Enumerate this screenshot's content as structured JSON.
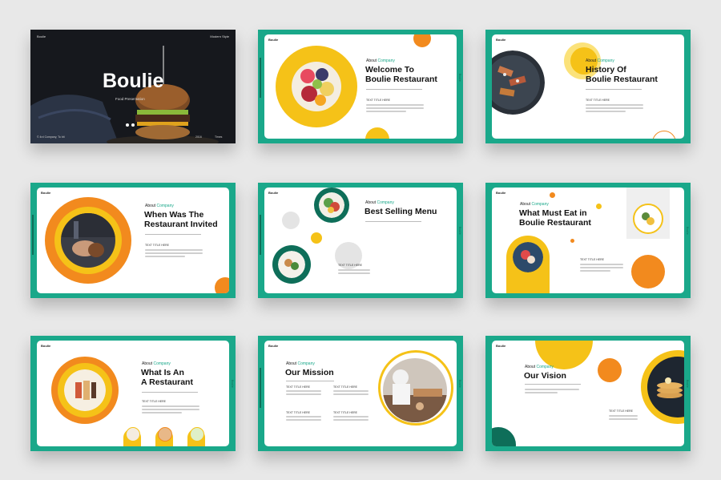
{
  "colors": {
    "green": "#1aa88a",
    "yellow": "#f5c218",
    "orange": "#f28a1e",
    "dark_green": "#0e6e59"
  },
  "slide1": {
    "brand": "Boulie",
    "tag": "Modern Style",
    "title": "Boulie",
    "subtitle": "Food Presentation",
    "footer_left": "© 4rd Company, To bit",
    "footer_year": "2016",
    "footer_right": "Times"
  },
  "slide2": {
    "brand": "Boulie",
    "eyebrow_a": "About",
    "eyebrow_b": "Company",
    "title_line1": "Welcome To",
    "title_line2": "Boulie Restaurant",
    "text_title": "TEXT TITLE HERE"
  },
  "slide3": {
    "brand": "Boulie",
    "eyebrow_a": "About",
    "eyebrow_b": "Company",
    "title_line1": "History Of",
    "title_line2": "Boulie Restaurant",
    "text_title": "TEXT TITLE HERE"
  },
  "slide4": {
    "brand": "Boulie",
    "eyebrow_a": "About",
    "eyebrow_b": "Company",
    "title_line1": "When Was The",
    "title_line2": "Restaurant Invited",
    "text_title": "TEXT TITLE HERE"
  },
  "slide5": {
    "brand": "Boulie",
    "eyebrow_a": "About",
    "eyebrow_b": "Company",
    "title_line1": "Best Selling Menu",
    "text_title": "TEXT TITLE HERE"
  },
  "slide6": {
    "brand": "Boulie",
    "eyebrow_a": "About",
    "eyebrow_b": "Company",
    "title_line1": "What Must Eat in",
    "title_line2": "Boulie Restaurant",
    "text_title": "TEXT TITLE HERE"
  },
  "slide7": {
    "brand": "Boulie",
    "eyebrow_a": "About",
    "eyebrow_b": "Company",
    "title_line1": "What Is An",
    "title_line2": "A Restaurant",
    "text_title": "TEXT TITLE HERE"
  },
  "slide8": {
    "brand": "Boulie",
    "eyebrow_a": "About",
    "eyebrow_b": "Company",
    "title_line1": "Our Mission",
    "text_title_1": "TEXT TITLE HERE",
    "text_title_2": "TEXT TITLE HERE",
    "text_title_3": "TEXT TITLE HERE",
    "text_title_4": "TEXT TITLE HERE"
  },
  "slide9": {
    "brand": "Boulie",
    "eyebrow_a": "About",
    "eyebrow_b": "Company",
    "title_line1": "Our Vision",
    "text_title": "TEXT TITLE HERE"
  },
  "icons": {
    "dot": "slide-nav-dot-icon",
    "logo": "brand-logo"
  }
}
